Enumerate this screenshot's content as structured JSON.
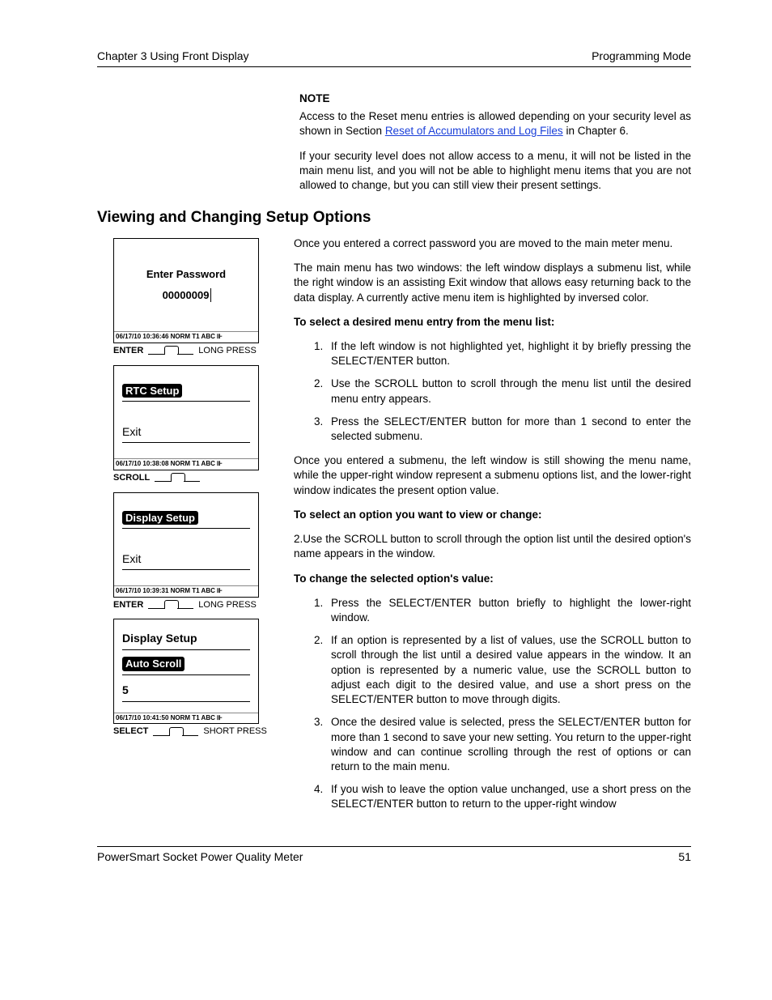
{
  "header": {
    "left": "Chapter 3 Using Front Display",
    "right": "Programming Mode"
  },
  "note": {
    "label": "NOTE",
    "p1a": "Access to the Reset menu entries is allowed depending on your security level as shown in Section ",
    "link": "Reset of Accumulators and Log Files",
    "p1b": " in Chapter 6.",
    "p2": "If your security level does not allow access to a menu, it will not be listed in the main menu list, and you will not be able to highlight menu items that you are not allowed to change, but you can still view their present settings."
  },
  "section_title": "Viewing and Changing Setup Options",
  "screens": [
    {
      "title": "Enter Password",
      "value": "00000009",
      "status": "06/17/10 10:36:46  NORM T1  ABC",
      "btn_left": "ENTER",
      "btn_right": "LONG PRESS"
    },
    {
      "line1_inv": "RTC Setup",
      "line2": "Exit",
      "status": "06/17/10 10:38:08  NORM T1  ABC",
      "btn_left": "SCROLL",
      "btn_right": ""
    },
    {
      "line1_inv": "Display Setup",
      "line2": "Exit",
      "status": "06/17/10 10:39:31  NORM T1  ABC",
      "btn_left": "ENTER",
      "btn_right": "LONG PRESS"
    },
    {
      "line0": "Display Setup",
      "line1_inv": "Auto Scroll",
      "line2": "5",
      "status": "06/17/10 10:41:50  NORM T1  ABC",
      "btn_left": "SELECT",
      "btn_right": "SHORT PRESS"
    }
  ],
  "body": {
    "p1": "Once you entered a correct password you are moved to the main meter menu.",
    "p2": "The main menu has two windows: the left window displays a submenu list, while the right window is an assisting Exit window that allows easy returning back to the data display. A currently active menu item is highlighted by inversed color.",
    "h3": "To select a desired menu entry from the menu list:",
    "ol1": [
      "If the left window is not highlighted yet, highlight it by briefly pressing the SELECT/ENTER button.",
      "Use the SCROLL button to scroll through the menu list until the desired menu entry appears.",
      "Press the SELECT/ENTER button for more than 1 second to enter the selected submenu."
    ],
    "p3": "Once you entered a submenu, the left window is still showing the menu name, while the upper-right window represent a submenu options list, and the lower-right window indicates the present option value.",
    "h4": "To select an option you want to view or change:",
    "p4": "2.Use the SCROLL button to scroll through the option list until the desired option's name appears in the window.",
    "h5": "To change the selected option's value:",
    "ol2": [
      "Press the SELECT/ENTER button briefly to highlight the lower-right window.",
      "If an option is represented by a list of values, use the SCROLL button to scroll through the list until a desired value appears in the window. It an option is represented by a numeric value, use the SCROLL button to adjust each digit to the desired value, and use a short press on the SELECT/ENTER button to move through digits.",
      "Once the desired value is selected, press the SELECT/ENTER button for more than 1 second to save your new setting. You return to the upper-right window and can continue scrolling through the rest of options or can return to the main menu.",
      " If you wish to leave the option value unchanged, use a short press on the SELECT/ENTER button to return to the upper-right window"
    ]
  },
  "footer": {
    "left": "PowerSmart Socket Power Quality Meter",
    "right": "51"
  }
}
